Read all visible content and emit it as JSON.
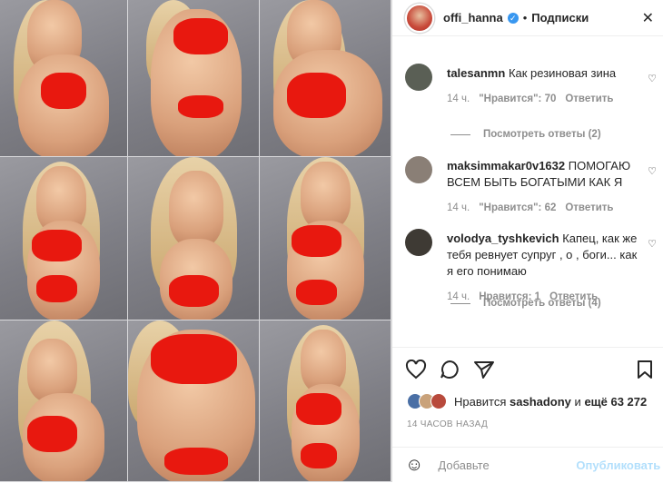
{
  "post": {
    "username": "offi_hanna",
    "verified_glyph": "✓",
    "separator": "•",
    "follow_status": "Подписки",
    "close_glyph": "✕"
  },
  "media": {
    "tiles": [
      {
        "desc": "photo-1"
      },
      {
        "desc": "photo-2"
      },
      {
        "desc": "photo-3"
      },
      {
        "desc": "photo-4"
      },
      {
        "desc": "photo-5"
      },
      {
        "desc": "photo-6"
      },
      {
        "desc": "photo-7"
      },
      {
        "desc": "photo-8"
      },
      {
        "desc": "photo-9"
      }
    ]
  },
  "comments": [
    {
      "user": "talesanmn",
      "text": "Как резиновая зина",
      "time": "14 ч.",
      "likes": "\"Нравится\": 70",
      "reply": "Ответить",
      "view_replies": "Посмотреть ответы (2)",
      "avatar_color": "#5a5f55"
    },
    {
      "user": "maksimmakar0v1632",
      "text": "ПОМОГАЮ ВСЕМ БЫТЬ БОГАТЫМИ КАК Я",
      "time": "14 ч.",
      "likes": "\"Нравится\": 62",
      "reply": "Ответить",
      "view_replies": "",
      "avatar_color": "#8a7f76"
    },
    {
      "user": "volodya_tyshkevich",
      "text": "Капец, как же тебя ревнует супруг , о , боги... как я его понимаю",
      "time": "14 ч.",
      "likes": "Нравится: 1",
      "reply": "Ответить",
      "view_replies": "Посмотреть ответы (4)",
      "avatar_color": "#3e3a34"
    }
  ],
  "likes_summary": {
    "prefix": "Нравится",
    "user": "sashadony",
    "middle": "и",
    "rest": "ещё 63 272"
  },
  "timestamp": "14 ЧАСОВ НАЗАД",
  "add_comment": {
    "placeholder": "Добавьте",
    "publish": "Опубликовать"
  },
  "colors": {
    "accent": "#3897f0",
    "publish_disabled": "#b2dffc",
    "swimsuit": "#e8180f"
  }
}
